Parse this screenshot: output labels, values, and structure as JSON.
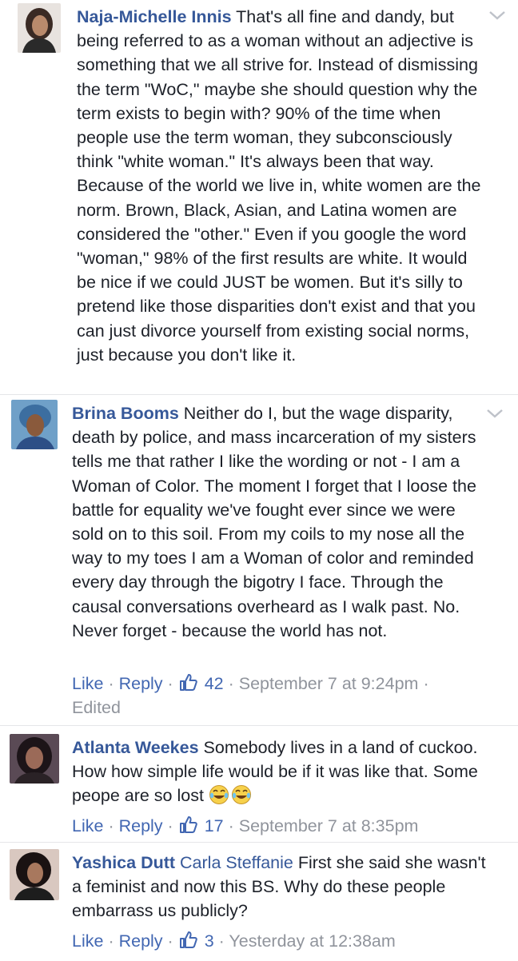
{
  "comments": [
    {
      "author": "Naja-Michelle Innis",
      "text": "That's all fine and dandy, but being referred to as a woman without an adjective is something that we all strive for. Instead of dismissing the term \"WoC,\" maybe she should question why the term exists to begin with? 90% of the time when people use the term woman, they subconsciously think \"white woman.\" It's always been that way. Because of the world we live in, white women are the norm. Brown, Black, Asian, and Latina women are considered the \"other.\" Even if you google the word \"woman,\" 98% of the first results are white. It would be nice if we could JUST be women. But it's silly to pretend like those disparities don't exist and that you can just divorce yourself from existing social norms, just because you don't like it."
    },
    {
      "author": "Brina Booms",
      "text": "Neither do I, but the wage disparity, death by police, and mass incarceration of my sisters tells me that rather I like the wording or not - I am a Woman of Color. The moment I forget that I loose the battle for equality we've fought ever since we were sold on to this soil. From my coils to my nose all the way to my toes I am a Woman of color and reminded every day through the bigotry I face. Through the causal conversations overheard as I walk past. No. Never forget - because the world has not.",
      "like_label": "Like",
      "reply_label": "Reply",
      "like_count": "42",
      "timestamp": "September 7 at 9:24pm",
      "edited": "Edited"
    },
    {
      "author": "Atlanta Weekes",
      "text": "Somebody lives in a land of cuckoo. How how simple life would be if it was like that. Some peope are so lost",
      "emoji": "tears-of-joy-emoji",
      "like_label": "Like",
      "reply_label": "Reply",
      "like_count": "17",
      "timestamp": "September 7 at 8:35pm"
    },
    {
      "author": "Yashica Dutt",
      "mention": "Carla Steffanie",
      "text": "First she said she wasn't a feminist and now this BS. Why do these people embarrass us publicly?",
      "like_label": "Like",
      "reply_label": "Reply",
      "like_count": "3",
      "timestamp": "Yesterday at 12:38am"
    }
  ],
  "separator": "·",
  "icons": {
    "options": "chevron-down-icon",
    "like": "thumbs-up-icon"
  },
  "colors": {
    "author": "#365899",
    "link": "#4267b2",
    "meta": "#90949c",
    "text": "#1d2129"
  }
}
